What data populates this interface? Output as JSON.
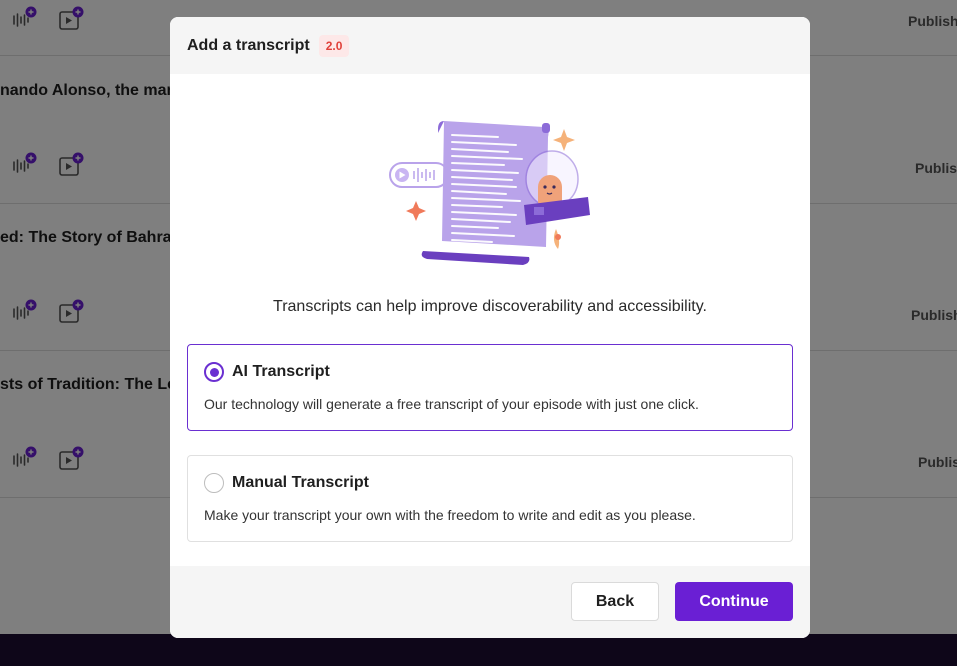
{
  "background": {
    "rows": [
      {
        "title": "",
        "status": "Publish"
      },
      {
        "title": "nando Alonso, the man",
        "status": "Publish"
      },
      {
        "title": "ed: The Story of Bahrai",
        "status": "Publish"
      },
      {
        "title": "sts of Tradition: The Le",
        "status": "Publish"
      }
    ]
  },
  "modal": {
    "title": "Add a transcript",
    "version_badge": "2.0",
    "subtitle": "Transcripts can help improve discoverability and accessibility.",
    "options": [
      {
        "title": "AI Transcript",
        "description": "Our technology will generate a free transcript of your episode with just one click.",
        "selected": true
      },
      {
        "title": "Manual Transcript",
        "description": "Make your transcript your own with the freedom to write and edit as you please.",
        "selected": false
      }
    ],
    "back_label": "Back",
    "continue_label": "Continue"
  },
  "colors": {
    "accent": "#6a1fd4",
    "badge_bg": "#fde8e8",
    "badge_text": "#e0413a",
    "footer_bar": "#1d0d33"
  },
  "icons": [
    "audio-add-icon",
    "video-add-icon",
    "radio-selected-icon",
    "radio-unselected-icon"
  ]
}
